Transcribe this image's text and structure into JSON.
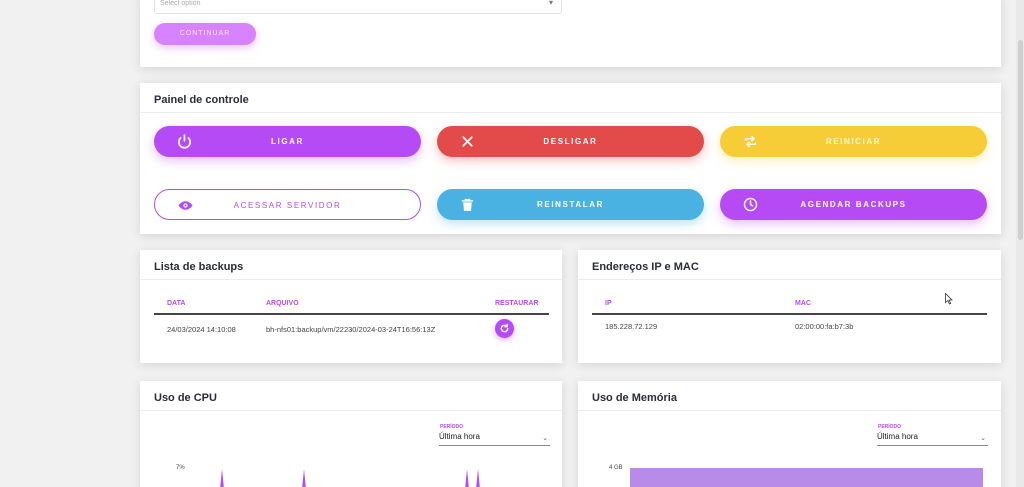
{
  "top_form": {
    "select_placeholder": "Select option",
    "submit_label": "CONTINUAR"
  },
  "panel": {
    "title": "Painel de controle",
    "buttons": [
      {
        "label": "LIGAR",
        "icon": "power-icon",
        "color": "#b64bf5"
      },
      {
        "label": "DESLIGAR",
        "icon": "close-icon",
        "color": "#e34a4a"
      },
      {
        "label": "REINICIAR",
        "icon": "repeat-icon",
        "color": "#f6cd36"
      },
      {
        "label": "ACESSAR SERVIDOR",
        "icon": "eye-icon",
        "color": "#b64bf5"
      },
      {
        "label": "REINSTALAR",
        "icon": "trash-icon",
        "color": "#4ab2e3"
      },
      {
        "label": "AGENDAR BACKUPS",
        "icon": "clock-icon",
        "color": "#b64bf5"
      }
    ]
  },
  "backups": {
    "title": "Lista de backups",
    "columns": [
      "DATA",
      "ARQUIVO",
      "RESTAURAR"
    ],
    "rows": [
      {
        "date": "24/03/2024 14:10:08",
        "file": "bh-nfs01:backup/vm/22230/2024-03-24T16:56:13Z",
        "action_icon": "restore-icon"
      }
    ]
  },
  "addresses": {
    "title": "Endereços IP e MAC",
    "columns": [
      "IP",
      "MAC"
    ],
    "rows": [
      {
        "ip": "185.228.72.129",
        "mac": "02:00:00:fa:b7:3b"
      }
    ]
  },
  "cpu": {
    "title": "Uso de CPU",
    "period_label": "PERÍODO",
    "period_value": "Última hora",
    "y_tick": "7%"
  },
  "memory": {
    "title": "Uso de Memória",
    "period_label": "PERÍODO",
    "period_value": "Última hora",
    "y_tick": "4 GB"
  },
  "colors": {
    "accent": "#b64bf5",
    "danger": "#e34a4a",
    "warning": "#f6cd36",
    "info": "#4ab2e3"
  }
}
